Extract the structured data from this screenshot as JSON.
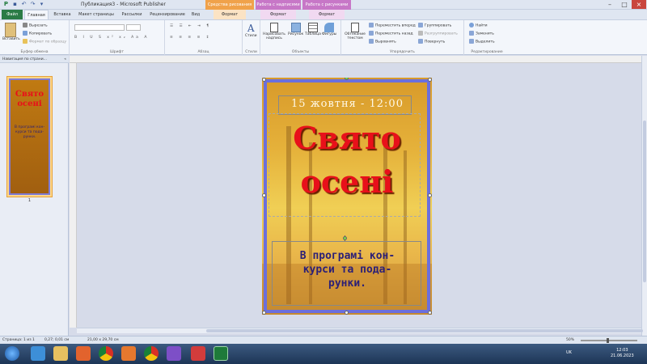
{
  "title": {
    "app_title": "Публикация3 - Microsoft Publisher"
  },
  "context_tabs": [
    {
      "group": "Средства рисования",
      "tab": "Формат",
      "color": "#f0a24a"
    },
    {
      "group": "Работа с надписями",
      "tab": "Формат",
      "color": "#c777c7"
    },
    {
      "group": "Работа с рисунками",
      "tab": "Формат",
      "color": "#c777c7"
    }
  ],
  "tabs": [
    "Файл",
    "Главная",
    "Вставка",
    "Макет страницы",
    "Рассылки",
    "Рецензирование",
    "Вид"
  ],
  "ribbon": {
    "clipboard": {
      "paste": "Вставить",
      "cut": "Вырезать",
      "copy": "Копировать",
      "format": "Формат по образцу",
      "label": "Буфер обмена"
    },
    "font": {
      "label": "Шрифт"
    },
    "paragraph": {
      "label": "Абзац"
    },
    "styles": {
      "btn": "Стили",
      "label": "Стили"
    },
    "objects": {
      "textbox": "Нарисовать надпись",
      "picture": "Рисунок",
      "table": "Таблица",
      "shapes": "Фигуры",
      "label": "Объекты"
    },
    "arrange": {
      "wrap": "Обтекание текстом",
      "forward": "Переместить вперед",
      "backward": "Переместить назад",
      "align": "Выровнять",
      "group": "Группировать",
      "ungroup": "Разгруппировать",
      "rotate": "Повернуть",
      "label": "Упорядочить"
    },
    "editing": {
      "find": "Найти",
      "replace": "Заменить",
      "select": "Выделить",
      "label": "Редактирование"
    }
  },
  "nav": {
    "header": "Навигация по страни...",
    "page_number": "1"
  },
  "thumb": {
    "title": "Свято осені",
    "body": "В програмі кон-курси та пода-рунки."
  },
  "poster": {
    "date": "15 жовтня - 12:00",
    "title_line1": "Свято",
    "title_line2": "осені",
    "body_line1": "В програмі кон-",
    "body_line2": "курси та пода-",
    "body_line3": "рунки."
  },
  "status": {
    "page": "Страница: 1 из 1",
    "position": "0,27; 0,01 см",
    "size": "21,00 x 29,70 см",
    "zoom": "50%"
  },
  "tray": {
    "lang": "UK",
    "time": "12:03",
    "date": "21.06.2023"
  }
}
